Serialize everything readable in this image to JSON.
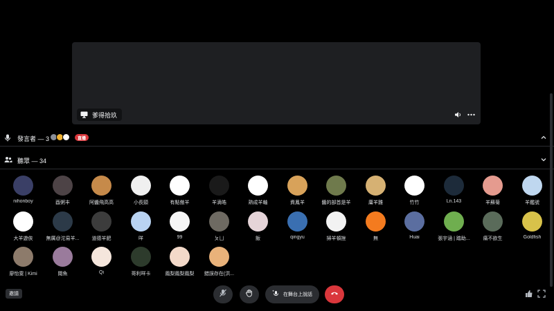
{
  "stream": {
    "label": "爹得拾玖",
    "icons": {
      "screen": "monitor-icon",
      "volume": "volume-icon",
      "more": "more-icon"
    }
  },
  "speakers": {
    "title": "發言者 — 3",
    "live_badge": "直播",
    "icon": "microphone-icon",
    "chevron": "chevron-up-icon"
  },
  "audience": {
    "title": "聽眾 — 34",
    "icon": "people-icon",
    "chevron": "chevron-down-icon",
    "members": [
      {
        "name": "nihonboy",
        "color": "#3a3f66"
      },
      {
        "name": "酉粥丰",
        "color": "#4d4346"
      },
      {
        "name": "阿醬飛高高",
        "color": "#c68a4a"
      },
      {
        "name": "小長頸",
        "color": "#f0f0f0"
      },
      {
        "name": "有點傲羊",
        "color": "#ffffff"
      },
      {
        "name": "羊滴皓",
        "color": "#1a1a1a"
      },
      {
        "name": "熟成羊軸",
        "color": "#ffffff"
      },
      {
        "name": "資鳳羊",
        "color": "#d8a25a"
      },
      {
        "name": "醬的部首是羊",
        "color": "#6f7a4c"
      },
      {
        "name": "庸羊雞",
        "color": "#d6b173"
      },
      {
        "name": "竹竹",
        "color": "#ffffff"
      },
      {
        "name": "Ln.143",
        "color": "#1d2b3a"
      },
      {
        "name": "羊蘇菊",
        "color": "#e59b8f"
      },
      {
        "name": "羊鑑號",
        "color": "#bfd7ef"
      },
      {
        "name": "大羊遊俠",
        "color": "#ffffff"
      },
      {
        "name": "無厲@沱易羊...",
        "color": "#2c3a48"
      },
      {
        "name": "道德羊肥",
        "color": "#3c3c3c"
      },
      {
        "name": "咩",
        "color": "#b9d3f2"
      },
      {
        "name": "99",
        "color": "#f5f5f5"
      },
      {
        "name": "ㄆㄩ",
        "color": "#6e6a62"
      },
      {
        "name": "飯",
        "color": "#e5d4d8"
      },
      {
        "name": "qingyu",
        "color": "#3a6fb1"
      },
      {
        "name": "掃羊頓挫",
        "color": "#f2f2f2"
      },
      {
        "name": "無",
        "color": "#f47b1f"
      },
      {
        "name": "Huai",
        "color": "#5b6ea0"
      },
      {
        "name": "張宇涵 | 踏助...",
        "color": "#6fae4f"
      },
      {
        "name": "痛不欲生",
        "color": "#5a6b5a"
      },
      {
        "name": "Goldfish",
        "color": "#d8c24a"
      },
      {
        "name": "廖怡雯 | Kimi",
        "color": "#8d7b6b"
      },
      {
        "name": "閱魚",
        "color": "#9a7b9c"
      },
      {
        "name": "Qi",
        "color": "#f5e6dc"
      },
      {
        "name": "哥利咩卡",
        "color": "#2d3b2c"
      },
      {
        "name": "鳳梨鳳梨鳳梨",
        "color": "#f3d9c9"
      },
      {
        "name": "錯誤存在(洪...",
        "color": "#e9b27a"
      }
    ]
  },
  "bottom_bar": {
    "invite_label": "邀請",
    "speak_label": "在舞台上說話",
    "colors": {
      "leave": "#da373c",
      "button": "#2b2d31"
    }
  }
}
